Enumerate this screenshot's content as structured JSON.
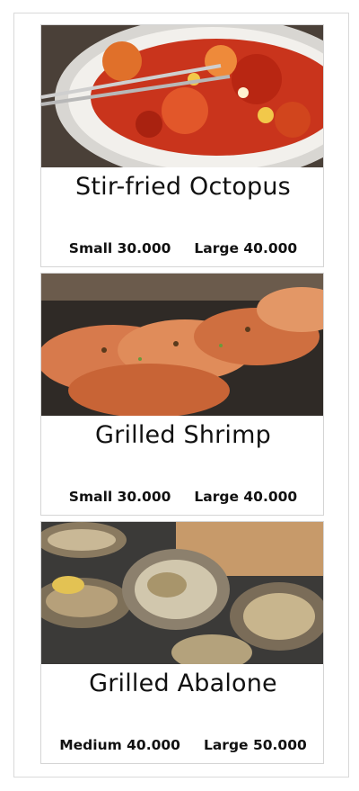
{
  "menu": {
    "items": [
      {
        "name": "Stir-fried Octopus",
        "prices": [
          {
            "label": "Small 30.000"
          },
          {
            "label": "Large 40.000"
          }
        ],
        "photo_icon": "octopus-dish-photo"
      },
      {
        "name": "Grilled Shrimp",
        "prices": [
          {
            "label": "Small 30.000"
          },
          {
            "label": "Large 40.000"
          }
        ],
        "photo_icon": "shrimp-dish-photo"
      },
      {
        "name": "Grilled Abalone",
        "prices": [
          {
            "label": "Medium 40.000"
          },
          {
            "label": "Large 50.000"
          }
        ],
        "photo_icon": "abalone-dish-photo"
      }
    ]
  },
  "colors": {
    "border": "#d5d5d5",
    "text": "#111111",
    "background": "#ffffff"
  }
}
